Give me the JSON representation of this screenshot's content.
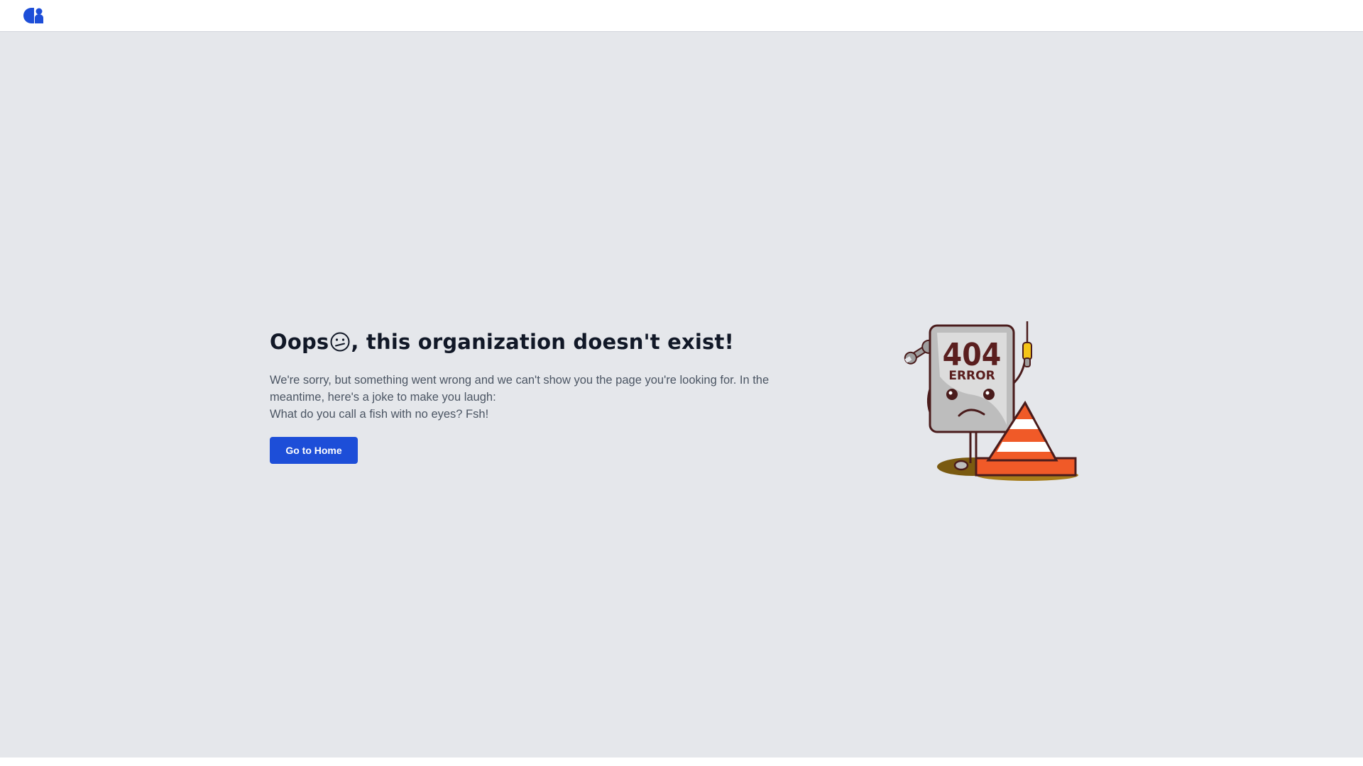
{
  "header": {
    "logo_icon": "company-logo-icon",
    "logo_color": "#1d4ed8"
  },
  "error_page": {
    "title_prefix": "Oops",
    "title_emoji": "confused-face-icon",
    "title_suffix": ", this organization doesn't exist!",
    "message_line1": "We're sorry, but something went wrong and we can't show you the page you're looking for. In the meantime, here's a joke to make you laugh:",
    "message_line2": "What do you call a fish with no eyes? Fsh!",
    "button_label": "Go to Home",
    "button_color": "#1d4ed8"
  },
  "illustration": {
    "icon": "404-error-character-with-traffic-cone",
    "code_text": "404",
    "error_text": "ERROR"
  }
}
